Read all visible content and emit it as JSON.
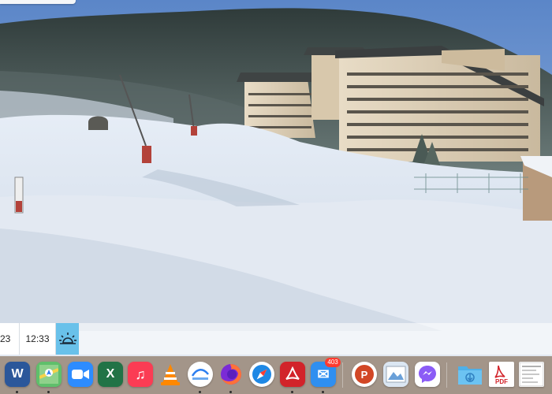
{
  "timeline": {
    "partial_time": "23",
    "current_time": "12:33"
  },
  "dock": {
    "apps": [
      {
        "name": "Microsoft Word",
        "icon": "word-icon",
        "glyph": "W",
        "color": "#2b579a"
      },
      {
        "name": "Maps",
        "icon": "maps-icon",
        "glyph": "",
        "color": "#5fbf6b"
      },
      {
        "name": "Zoom",
        "icon": "zoom-icon",
        "glyph": "",
        "color": "#2d8cff"
      },
      {
        "name": "Microsoft Excel",
        "icon": "excel-icon",
        "glyph": "X",
        "color": "#217346"
      },
      {
        "name": "Music",
        "icon": "music-icon",
        "glyph": "♫",
        "color": "#fb3c54"
      },
      {
        "name": "VLC",
        "icon": "vlc-icon",
        "glyph": "",
        "color": "#ff8800"
      },
      {
        "name": "Migration Assistant",
        "icon": "migration-icon",
        "glyph": "",
        "color": "#ffffff"
      },
      {
        "name": "Firefox",
        "icon": "firefox-icon",
        "glyph": "",
        "color": "#ff7139"
      },
      {
        "name": "Safari",
        "icon": "safari-icon",
        "glyph": "",
        "color": "#1e88e5"
      },
      {
        "name": "Adobe Acrobat",
        "icon": "acrobat-icon",
        "glyph": "",
        "color": "#d2232a"
      },
      {
        "name": "Mail",
        "icon": "mail-icon",
        "glyph": "✉",
        "color": "#2f8ff0",
        "badge": "403"
      },
      {
        "name": "Microsoft PowerPoint",
        "icon": "powerpoint-icon",
        "glyph": "P",
        "color": "#d24726"
      },
      {
        "name": "Preview",
        "icon": "preview-icon",
        "glyph": "",
        "color": "#dbe6f2"
      },
      {
        "name": "Messenger",
        "icon": "messenger-icon",
        "glyph": "",
        "color": "#ffffff"
      },
      {
        "name": "Downloads",
        "icon": "downloads-folder-icon",
        "glyph": "",
        "color": "#4fb0e8"
      },
      {
        "name": "PDF Document",
        "icon": "pdf-file-icon",
        "glyph": "PDF",
        "color": "#ffffff"
      },
      {
        "name": "Document",
        "icon": "document-thumbnail-icon",
        "glyph": "",
        "color": "#f2f2f2"
      }
    ]
  }
}
